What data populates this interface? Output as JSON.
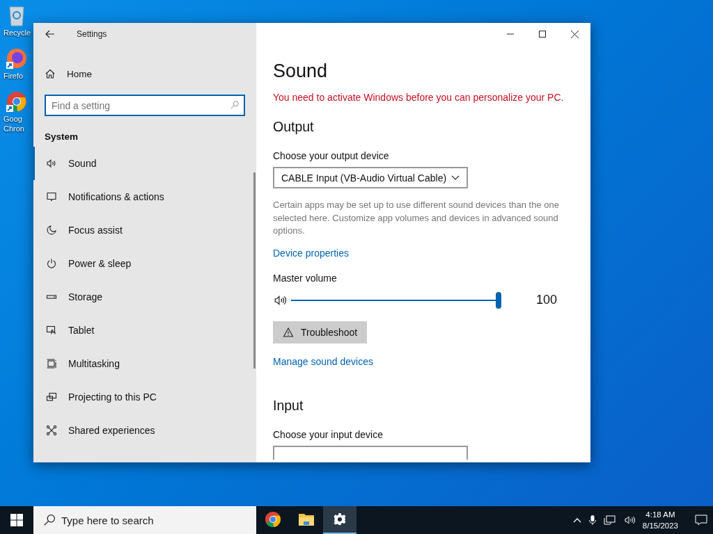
{
  "desktop_icons": [
    {
      "label": "Recycle"
    },
    {
      "label": "Firefo"
    },
    {
      "label": "Goog Chron"
    }
  ],
  "window": {
    "title": "Settings"
  },
  "sidebar": {
    "home": "Home",
    "search": {
      "placeholder": "Find a setting"
    },
    "section": "System",
    "items": [
      {
        "label": "Sound",
        "selected": true
      },
      {
        "label": "Notifications & actions",
        "selected": false
      },
      {
        "label": "Focus assist",
        "selected": false
      },
      {
        "label": "Power & sleep",
        "selected": false
      },
      {
        "label": "Storage",
        "selected": false
      },
      {
        "label": "Tablet",
        "selected": false
      },
      {
        "label": "Multitasking",
        "selected": false
      },
      {
        "label": "Projecting to this PC",
        "selected": false
      },
      {
        "label": "Shared experiences",
        "selected": false
      }
    ]
  },
  "page": {
    "title": "Sound",
    "warning": "You need to activate Windows before you can personalize your PC.",
    "output": {
      "heading": "Output",
      "device_label": "Choose your output device",
      "device": "CABLE Input (VB-Audio Virtual Cable)",
      "description": "Certain apps may be set up to use different sound devices than the one selected here. Customize app volumes and devices in advanced sound options.",
      "properties_link": "Device properties",
      "volume_label": "Master volume",
      "volume": {
        "level": 1.0
      },
      "volume_reading": "100",
      "troubleshoot": "Troubleshoot",
      "manage_link": "Manage sound devices"
    },
    "input": {
      "heading": "Input",
      "device_label": "Choose your input device"
    }
  },
  "taskbar": {
    "search": {
      "placeholder": "Type here to search"
    },
    "apps": [
      {
        "selected": false
      },
      {
        "selected": false
      },
      {
        "selected": true
      }
    ],
    "time": "4:18 AM",
    "date": "8/15/2023"
  }
}
